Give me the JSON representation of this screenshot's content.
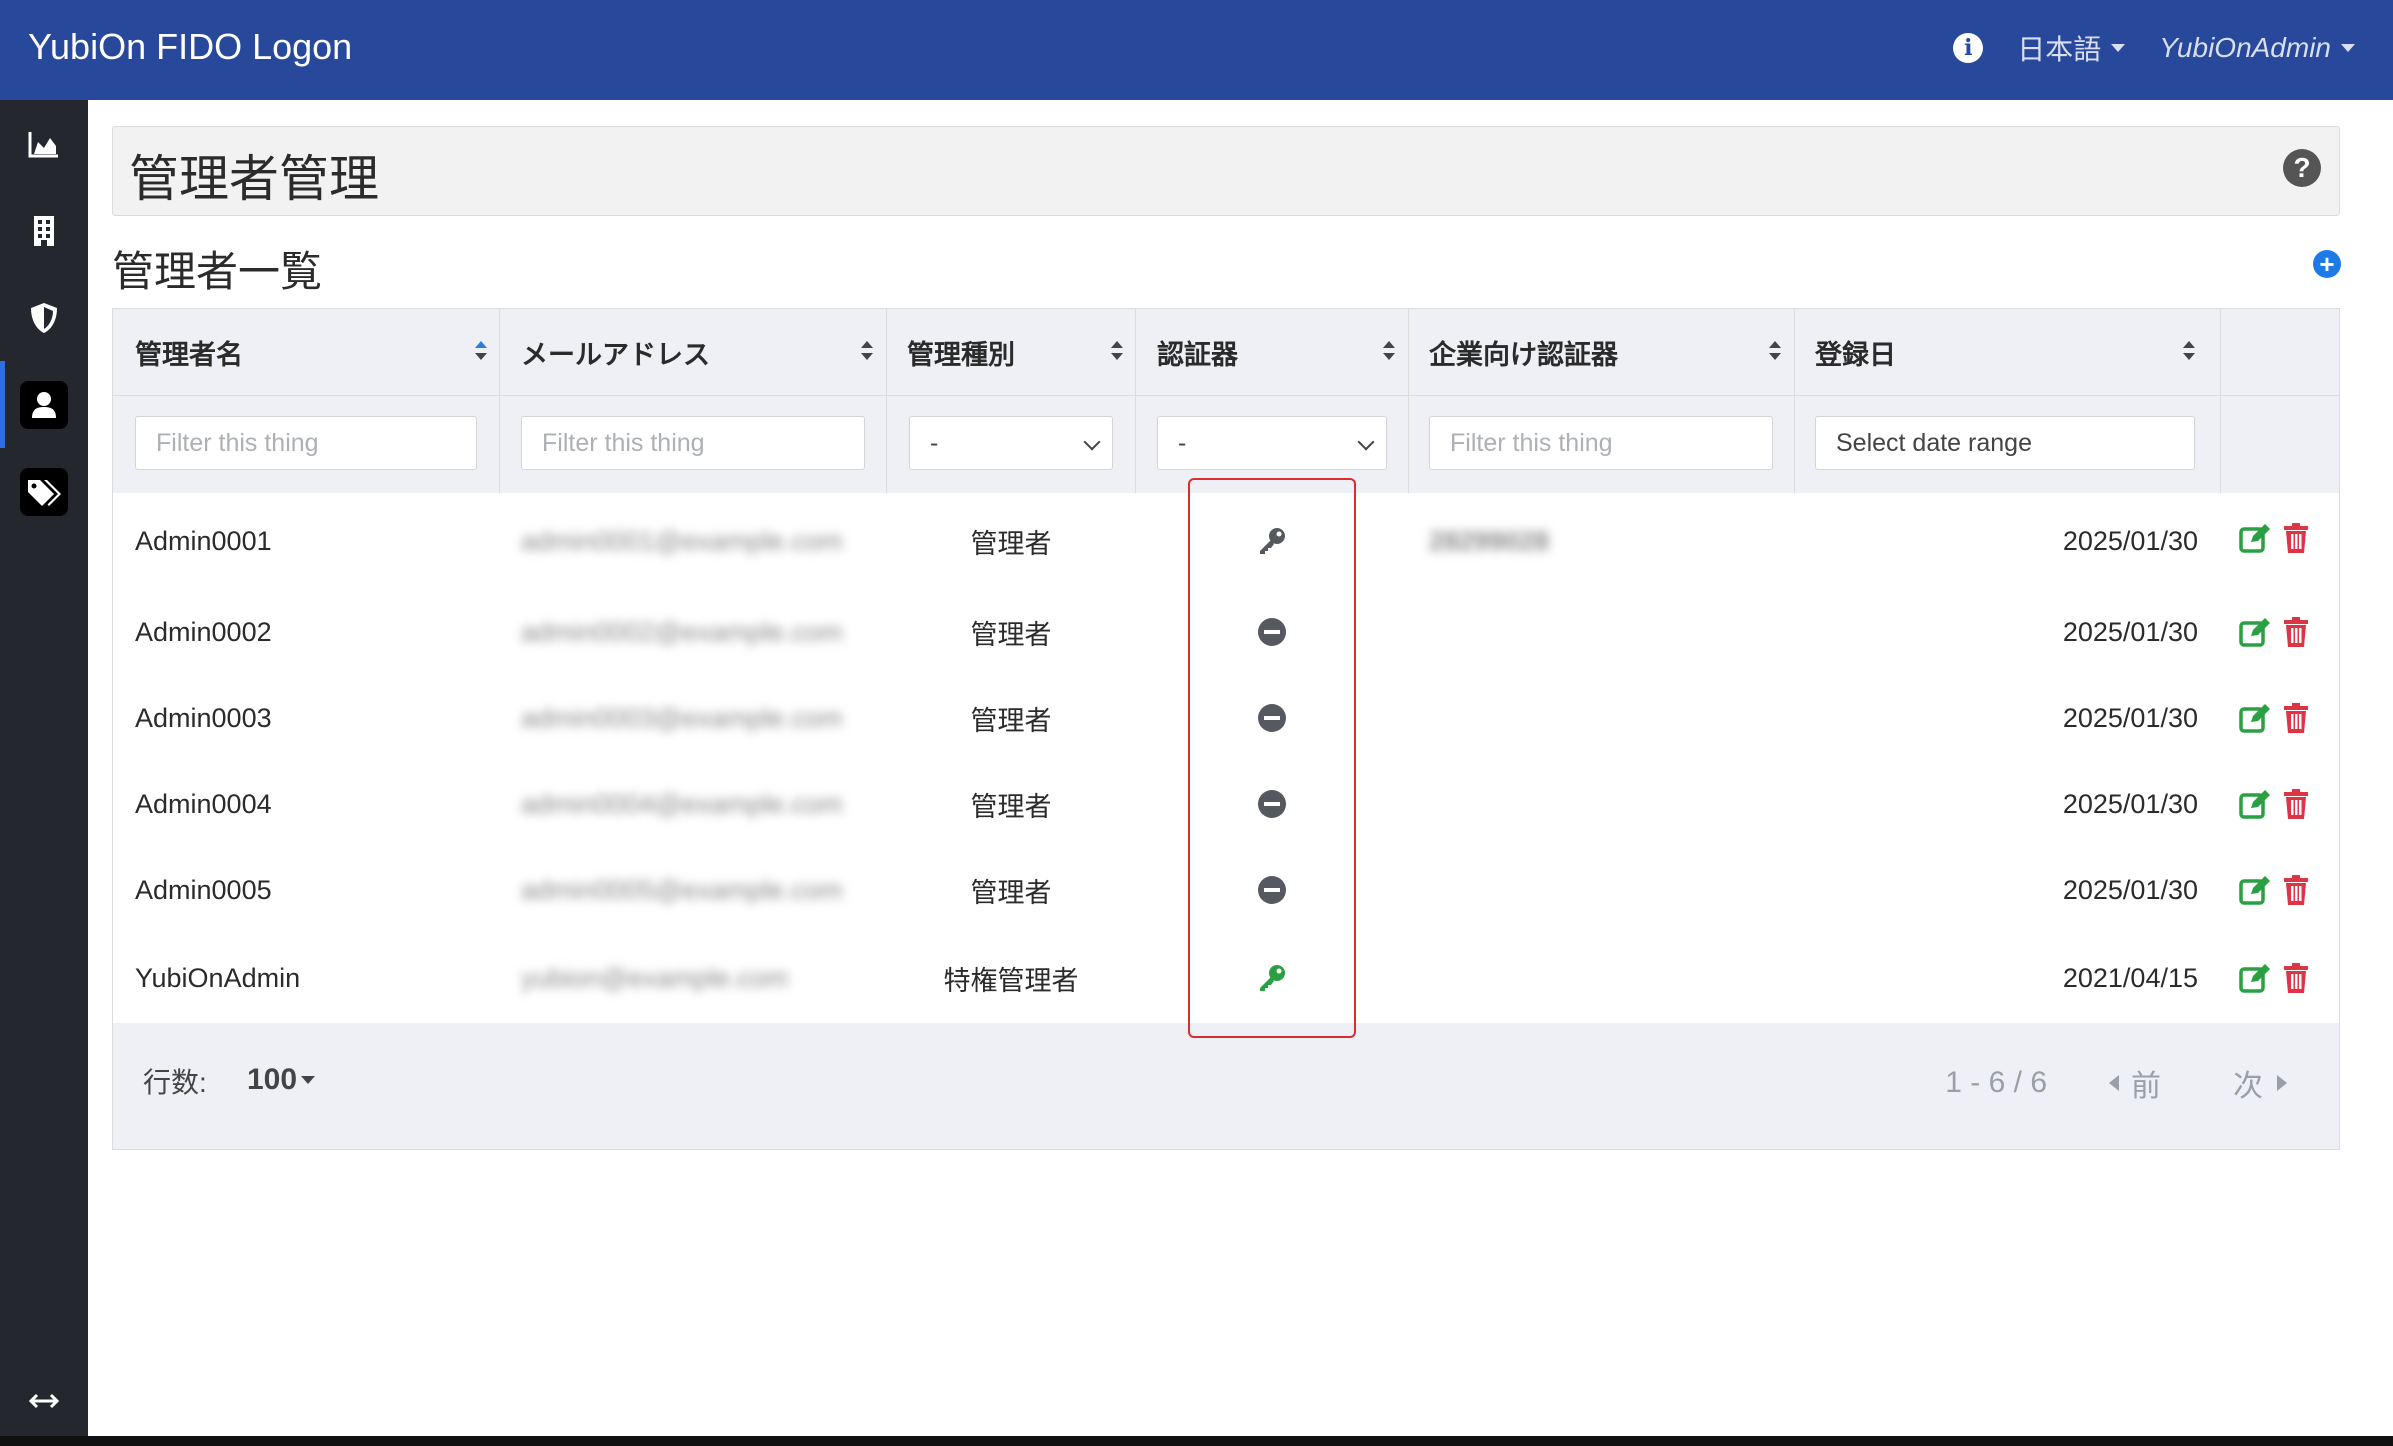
{
  "app": {
    "title": "YubiOn FIDO Logon"
  },
  "navbar": {
    "info_icon": "info-icon",
    "language": "日本語",
    "user": "YubiOnAdmin"
  },
  "sidebar": {
    "items": [
      {
        "icon": "area-chart-icon"
      },
      {
        "icon": "building-icon"
      },
      {
        "icon": "shield-icon"
      },
      {
        "icon": "user-icon",
        "active": true
      },
      {
        "icon": "tags-icon"
      }
    ],
    "bottom_icon": "expand-arrows-icon"
  },
  "page": {
    "title": "管理者管理",
    "section_title": "管理者一覧"
  },
  "table": {
    "headers": [
      "管理者名",
      "メールアドレス",
      "管理種別",
      "認証器",
      "企業向け認証器",
      "登録日"
    ],
    "filters": {
      "name_placeholder": "Filter this thing",
      "email_placeholder": "Filter this thing",
      "type_value": "-",
      "auth_value": "-",
      "enterprise_placeholder": "Filter this thing",
      "date_placeholder": "Select date range"
    },
    "rows": [
      {
        "name": "Admin0001",
        "email": "admin0001@example.com",
        "type": "管理者",
        "authenticator": "key",
        "enterprise": "28299028",
        "date": "2025/01/30"
      },
      {
        "name": "Admin0002",
        "email": "admin0002@example.com",
        "type": "管理者",
        "authenticator": "none",
        "enterprise": "",
        "date": "2025/01/30"
      },
      {
        "name": "Admin0003",
        "email": "admin0003@example.com",
        "type": "管理者",
        "authenticator": "none",
        "enterprise": "",
        "date": "2025/01/30"
      },
      {
        "name": "Admin0004",
        "email": "admin0004@example.com",
        "type": "管理者",
        "authenticator": "none",
        "enterprise": "",
        "date": "2025/01/30"
      },
      {
        "name": "Admin0005",
        "email": "admin0005@example.com",
        "type": "管理者",
        "authenticator": "none",
        "enterprise": "",
        "date": "2025/01/30"
      },
      {
        "name": "YubiOnAdmin",
        "email": "yubion@example.com",
        "type": "特権管理者",
        "authenticator": "key-green",
        "enterprise": "",
        "date": "2021/04/15"
      }
    ]
  },
  "footer": {
    "rows_label": "行数:",
    "rows_value": "100",
    "range": "1 - 6 / 6",
    "prev": "前",
    "next": "次"
  },
  "colors": {
    "navbar": "#27489b",
    "sidebar": "#24272d",
    "edit": "#2aa043",
    "delete": "#dc3545",
    "highlight": "#d92e2e"
  }
}
